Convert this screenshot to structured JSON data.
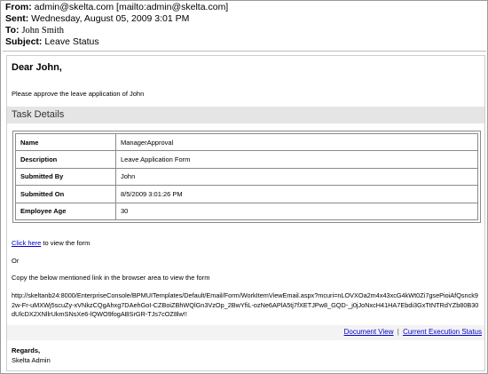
{
  "header": {
    "from_label": "From:",
    "from_value": "admin@skelta.com [mailto:admin@skelta.com]",
    "sent_label": "Sent:",
    "sent_value": "Wednesday, August 05, 2009 3:01 PM",
    "to_label": "To:",
    "to_value": "John Smith",
    "subject_label": "Subject:",
    "subject_value": "Leave Status"
  },
  "message": {
    "greeting": "Dear John,",
    "intro": "Please approve the leave application of John",
    "task_section_title": "Task Details",
    "details": [
      {
        "key": "Name",
        "value": "ManagerApproval"
      },
      {
        "key": "Description",
        "value": "Leave Application Form"
      },
      {
        "key": "Submitted By",
        "value": "John"
      },
      {
        "key": "Submitted On",
        "value": "8/5/2009 3:01:26 PM"
      },
      {
        "key": "Employee Age",
        "value": "30"
      }
    ],
    "click_link": "Click here",
    "click_suffix": " to view the form",
    "or_text": "Or",
    "copy_text": "Copy the below mentioned link in the browser area to view the form",
    "url_text": "http://skeltanb24:8000/EnterpriseConsole/BPMUITemplates/Default/Email/Form/WorkItemViewEmail.aspx?mcuri=nLOVXOa2m4x43xcG4kWt0Zi7gsePioiAfQsnck92w-Fr-uMXWj5scuZy-xVNkzCQgAhxg7DAehGoI-CZBoiZBhWQlGn3VzOp_2BwYfiL-ozNe6APlA5tj7fXETJPw8_GQD-_j0jJoNxcH41HA7Ebdi3GxTtNTRdYZb80B30dUlcDX2XNllrUkmSNsXe6-lQWO9fogABSrGR-TJs7cOZ8lw!!",
    "footer_links": {
      "document_view": "Document View",
      "separator": "|",
      "current_execution_status": "Current Execution Status"
    },
    "regards": "Regards,",
    "signature": "Skelta Admin"
  }
}
